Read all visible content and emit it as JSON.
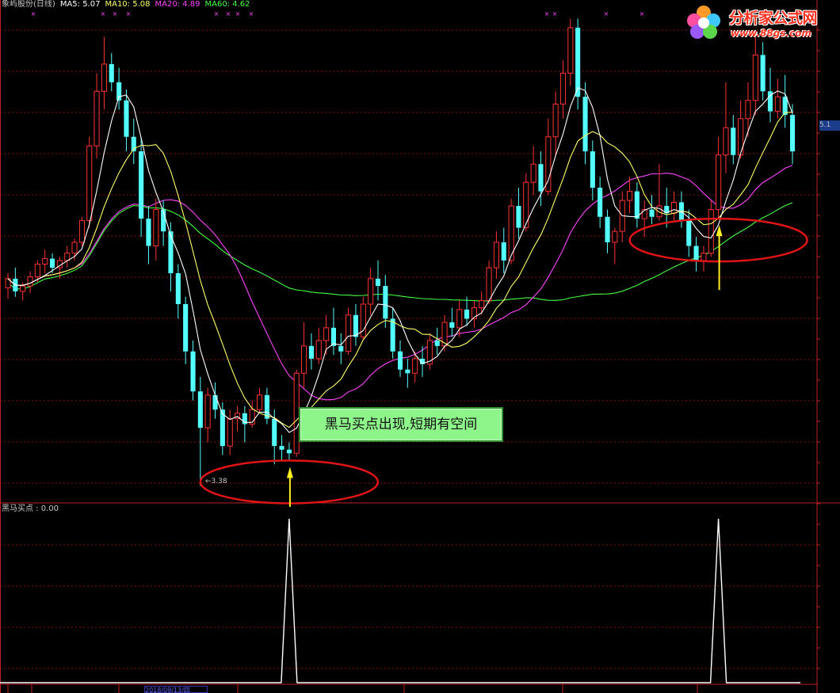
{
  "header": {
    "title": "象屿股份(日线)",
    "ma5": "MA5: 5.07",
    "ma10": "MA10: 5.08",
    "ma20": "MA20: 4.89",
    "ma60": "MA60: 4.62",
    "colors": {
      "title": "#c8c8c8",
      "ma5": "#ffffff",
      "ma10": "#ffff66",
      "ma20": "#ff44ff",
      "ma60": "#44ff44"
    }
  },
  "logo": {
    "title": "分析家公式网",
    "url": "www.88gs.com"
  },
  "annotation": {
    "text": "黑马买点出现,短期有空间"
  },
  "lower_panel": {
    "label": "黑马买点 : 0.00"
  },
  "low_price_marker": "←3.38",
  "price_tag": "5.1",
  "date_label": "2018/09/13/四",
  "chart_data": {
    "type": "candlestick",
    "y_range": [
      3.3,
      6.0
    ],
    "colors": {
      "up": "#ff3232",
      "down": "#54ffff",
      "ma5": "#ffffff",
      "ma10": "#ffff66",
      "ma20": "#ff44ff",
      "ma60": "#44ff44",
      "signal": "#ffffff"
    },
    "candles": [
      [
        4.47,
        4.55,
        4.41,
        4.52
      ],
      [
        4.52,
        4.58,
        4.42,
        4.45
      ],
      [
        4.45,
        4.5,
        4.4,
        4.48
      ],
      [
        4.48,
        4.56,
        4.44,
        4.53
      ],
      [
        4.53,
        4.62,
        4.5,
        4.6
      ],
      [
        4.6,
        4.68,
        4.55,
        4.63
      ],
      [
        4.63,
        4.66,
        4.55,
        4.58
      ],
      [
        4.58,
        4.64,
        4.52,
        4.62
      ],
      [
        4.62,
        4.7,
        4.58,
        4.66
      ],
      [
        4.66,
        4.74,
        4.62,
        4.72
      ],
      [
        4.72,
        4.86,
        4.7,
        4.84
      ],
      [
        4.84,
        5.3,
        4.8,
        5.25
      ],
      [
        5.25,
        5.65,
        5.18,
        5.55
      ],
      [
        5.55,
        5.85,
        5.45,
        5.7
      ],
      [
        5.7,
        5.76,
        5.55,
        5.6
      ],
      [
        5.6,
        5.68,
        5.45,
        5.5
      ],
      [
        5.5,
        5.56,
        5.22,
        5.3
      ],
      [
        5.3,
        5.4,
        5.15,
        5.22
      ],
      [
        5.22,
        5.3,
        4.75,
        4.85
      ],
      [
        4.85,
        4.92,
        4.6,
        4.7
      ],
      [
        4.7,
        4.96,
        4.62,
        4.9
      ],
      [
        4.9,
        4.95,
        4.7,
        4.78
      ],
      [
        4.78,
        4.83,
        4.45,
        4.55
      ],
      [
        4.55,
        4.6,
        4.3,
        4.38
      ],
      [
        4.38,
        4.42,
        4.05,
        4.12
      ],
      [
        4.12,
        4.18,
        3.85,
        3.9
      ],
      [
        3.9,
        3.98,
        3.38,
        3.7
      ],
      [
        3.7,
        3.92,
        3.62,
        3.88
      ],
      [
        3.88,
        3.95,
        3.75,
        3.8
      ],
      [
        3.8,
        3.84,
        3.55,
        3.6
      ],
      [
        3.6,
        3.8,
        3.55,
        3.75
      ],
      [
        3.75,
        3.82,
        3.68,
        3.78
      ],
      [
        3.78,
        3.82,
        3.62,
        3.72
      ],
      [
        3.72,
        3.85,
        3.7,
        3.8
      ],
      [
        3.8,
        3.92,
        3.78,
        3.88
      ],
      [
        3.88,
        3.92,
        3.72,
        3.75
      ],
      [
        3.75,
        3.8,
        3.5,
        3.6
      ],
      [
        3.6,
        3.66,
        3.52,
        3.58
      ],
      [
        3.58,
        3.62,
        3.52,
        3.56
      ],
      [
        3.56,
        4.02,
        3.54,
        4.0
      ],
      [
        4.0,
        4.28,
        3.92,
        4.15
      ],
      [
        4.15,
        4.22,
        4.02,
        4.08
      ],
      [
        4.08,
        4.25,
        4.05,
        4.18
      ],
      [
        4.18,
        4.32,
        4.1,
        4.25
      ],
      [
        4.25,
        4.36,
        4.1,
        4.15
      ],
      [
        4.15,
        4.22,
        4.05,
        4.12
      ],
      [
        4.12,
        4.36,
        4.1,
        4.32
      ],
      [
        4.32,
        4.38,
        4.15,
        4.2
      ],
      [
        4.2,
        4.42,
        4.18,
        4.38
      ],
      [
        4.38,
        4.58,
        4.32,
        4.52
      ],
      [
        4.52,
        4.62,
        4.4,
        4.48
      ],
      [
        4.48,
        4.54,
        4.25,
        4.3
      ],
      [
        4.3,
        4.36,
        4.08,
        4.12
      ],
      [
        4.12,
        4.18,
        3.98,
        4.02
      ],
      [
        4.02,
        4.08,
        3.92,
        4.0
      ],
      [
        4.0,
        4.12,
        3.95,
        4.08
      ],
      [
        4.08,
        4.15,
        3.98,
        4.05
      ],
      [
        4.05,
        4.22,
        4.02,
        4.18
      ],
      [
        4.18,
        4.25,
        4.1,
        4.15
      ],
      [
        4.15,
        4.32,
        4.12,
        4.28
      ],
      [
        4.28,
        4.36,
        4.2,
        4.25
      ],
      [
        4.25,
        4.4,
        4.2,
        4.35
      ],
      [
        4.35,
        4.42,
        4.26,
        4.3
      ],
      [
        4.3,
        4.4,
        4.25,
        4.36
      ],
      [
        4.36,
        4.45,
        4.32,
        4.4
      ],
      [
        4.4,
        4.62,
        4.38,
        4.58
      ],
      [
        4.58,
        4.78,
        4.52,
        4.72
      ],
      [
        4.72,
        4.8,
        4.55,
        4.62
      ],
      [
        4.62,
        4.96,
        4.6,
        4.92
      ],
      [
        4.92,
        5.02,
        4.74,
        4.8
      ],
      [
        4.8,
        5.1,
        4.78,
        5.05
      ],
      [
        5.05,
        5.25,
        4.98,
        5.15
      ],
      [
        5.15,
        5.22,
        4.92,
        5.0
      ],
      [
        5.0,
        5.4,
        4.98,
        5.3
      ],
      [
        5.3,
        5.55,
        5.2,
        5.48
      ],
      [
        5.48,
        5.72,
        5.4,
        5.65
      ],
      [
        5.65,
        5.95,
        5.58,
        5.9
      ],
      [
        5.9,
        5.95,
        5.45,
        5.52
      ],
      [
        5.52,
        5.6,
        5.15,
        5.22
      ],
      [
        5.22,
        5.28,
        4.95,
        5.02
      ],
      [
        5.02,
        5.08,
        4.8,
        4.86
      ],
      [
        4.86,
        4.9,
        4.66,
        4.72
      ],
      [
        4.72,
        4.8,
        4.6,
        4.78
      ],
      [
        4.78,
        5.0,
        4.72,
        4.95
      ],
      [
        4.95,
        5.08,
        4.88,
        5.0
      ],
      [
        5.0,
        5.05,
        4.8,
        4.85
      ],
      [
        4.85,
        4.95,
        4.75,
        4.9
      ],
      [
        4.9,
        4.98,
        4.82,
        4.86
      ],
      [
        4.86,
        5.15,
        4.84,
        4.92
      ],
      [
        4.92,
        5.02,
        4.8,
        4.88
      ],
      [
        4.88,
        5.0,
        4.84,
        4.94
      ],
      [
        4.94,
        5.0,
        4.8,
        4.84
      ],
      [
        4.84,
        4.9,
        4.64,
        4.7
      ],
      [
        4.7,
        4.75,
        4.56,
        4.62
      ],
      [
        4.62,
        4.7,
        4.56,
        4.66
      ],
      [
        4.66,
        4.95,
        4.64,
        4.9
      ],
      [
        4.9,
        5.3,
        4.85,
        5.2
      ],
      [
        5.2,
        5.6,
        5.1,
        5.35
      ],
      [
        5.35,
        5.42,
        5.15,
        5.2
      ],
      [
        5.2,
        5.5,
        5.18,
        5.4
      ],
      [
        5.4,
        5.6,
        5.3,
        5.5
      ],
      [
        5.5,
        5.85,
        5.42,
        5.75
      ],
      [
        5.75,
        5.82,
        5.5,
        5.55
      ],
      [
        5.55,
        5.68,
        5.38,
        5.44
      ],
      [
        5.44,
        5.62,
        5.4,
        5.52
      ],
      [
        5.52,
        5.64,
        5.35,
        5.42
      ],
      [
        5.42,
        5.48,
        5.15,
        5.22
      ]
    ],
    "signals": [
      {
        "index": 38,
        "value": 1
      },
      {
        "index": 96,
        "value": 1
      }
    ]
  }
}
